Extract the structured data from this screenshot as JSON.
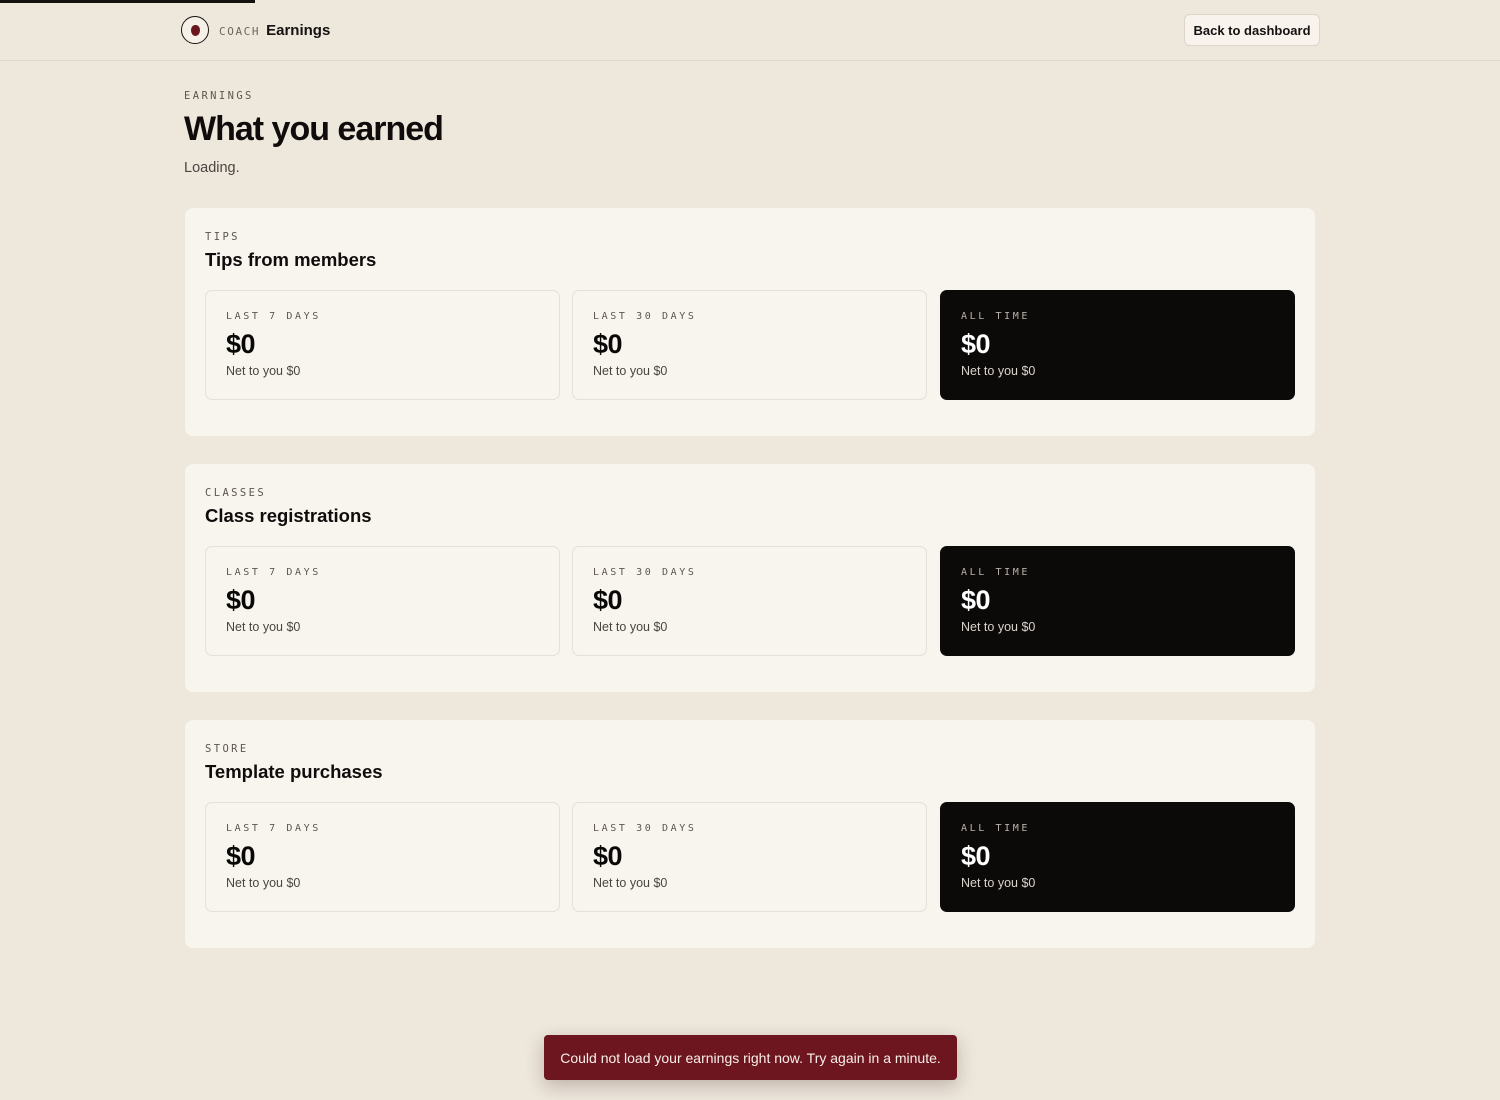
{
  "topbar": {
    "brand_prefix": "COACH",
    "brand_title": "Earnings",
    "back_button": "Back to dashboard",
    "logo_icon": "shield-icon"
  },
  "loading_progress": 0.17,
  "header": {
    "eyebrow": "EARNINGS",
    "title": "What you earned",
    "status": "Loading."
  },
  "sections": [
    {
      "eyebrow": "TIPS",
      "title": "Tips from members",
      "cards": [
        {
          "label": "LAST 7 DAYS",
          "value": "$0",
          "net": "Net to you $0"
        },
        {
          "label": "LAST 30 DAYS",
          "value": "$0",
          "net": "Net to you $0"
        },
        {
          "label": "ALL TIME",
          "value": "$0",
          "net": "Net to you $0"
        }
      ]
    },
    {
      "eyebrow": "CLASSES",
      "title": "Class registrations",
      "cards": [
        {
          "label": "LAST 7 DAYS",
          "value": "$0",
          "net": "Net to you $0"
        },
        {
          "label": "LAST 30 DAYS",
          "value": "$0",
          "net": "Net to you $0"
        },
        {
          "label": "ALL TIME",
          "value": "$0",
          "net": "Net to you $0"
        }
      ]
    },
    {
      "eyebrow": "STORE",
      "title": "Template purchases",
      "cards": [
        {
          "label": "LAST 7 DAYS",
          "value": "$0",
          "net": "Net to you $0"
        },
        {
          "label": "LAST 30 DAYS",
          "value": "$0",
          "net": "Net to you $0"
        },
        {
          "label": "ALL TIME",
          "value": "$0",
          "net": "Net to you $0"
        }
      ]
    }
  ],
  "toast": {
    "message": "Could not load your earnings right now. Try again in a minute."
  },
  "colors": {
    "background": "#ede7dc",
    "panel": "#f8f5ef",
    "dark_card": "#0c0a09",
    "toast_error": "#6e1620"
  }
}
